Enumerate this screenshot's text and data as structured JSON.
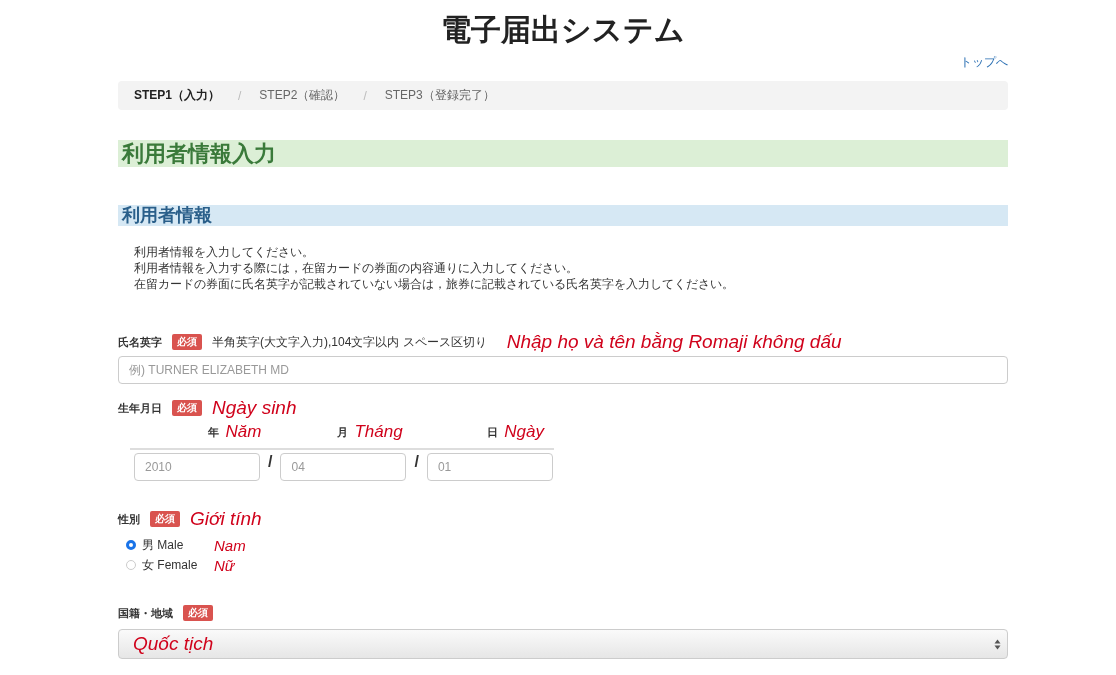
{
  "title": "電子届出システム",
  "top_link": "トップへ",
  "steps": [
    {
      "label": "STEP1（入力）",
      "selected": true
    },
    {
      "label": "STEP2（確認）",
      "selected": false
    },
    {
      "label": "STEP3（登録完了）",
      "selected": false
    }
  ],
  "step_separators": [
    "/",
    "/"
  ],
  "page_heading": "利用者情報入力",
  "section_heading": "利用者情報",
  "instructions": [
    "利用者情報を入力してください。",
    "利用者情報を入力する際には，在留カードの券面の内容通りに入力してください。",
    "在留カードの券面に氏名英字が記載されていない場合は，旅券に記載されている氏名英字を入力してください。"
  ],
  "name_field": {
    "label": "氏名英字",
    "badge": "必須",
    "hint": "半角英字(大文字入力),104文字以内  スペース区切り",
    "annotation": "Nhập họ và tên bằng Romaji không dấu",
    "placeholder": "例) TURNER ELIZABETH MD"
  },
  "birthdate": {
    "label": "生年月日",
    "badge": "必須",
    "annotation": "Ngày sinh",
    "parts": [
      {
        "unit": "年",
        "annotation": "Năm",
        "placeholder": "2010"
      },
      {
        "unit": "月",
        "annotation": "Tháng",
        "placeholder": "04"
      },
      {
        "unit": "日",
        "annotation": "Ngày",
        "placeholder": "01"
      }
    ],
    "separators": [
      "/",
      "/"
    ]
  },
  "gender": {
    "label": "性別",
    "badge": "必須",
    "annotation": "Giới tính",
    "options": [
      {
        "label": "男 Male",
        "annotation": "Nam",
        "selected": true
      },
      {
        "label": "女 Female",
        "annotation": "Nữ",
        "selected": false
      }
    ]
  },
  "nationality": {
    "label": "国籍・地域",
    "badge": "必須",
    "annotation": "Quốc tịch"
  }
}
